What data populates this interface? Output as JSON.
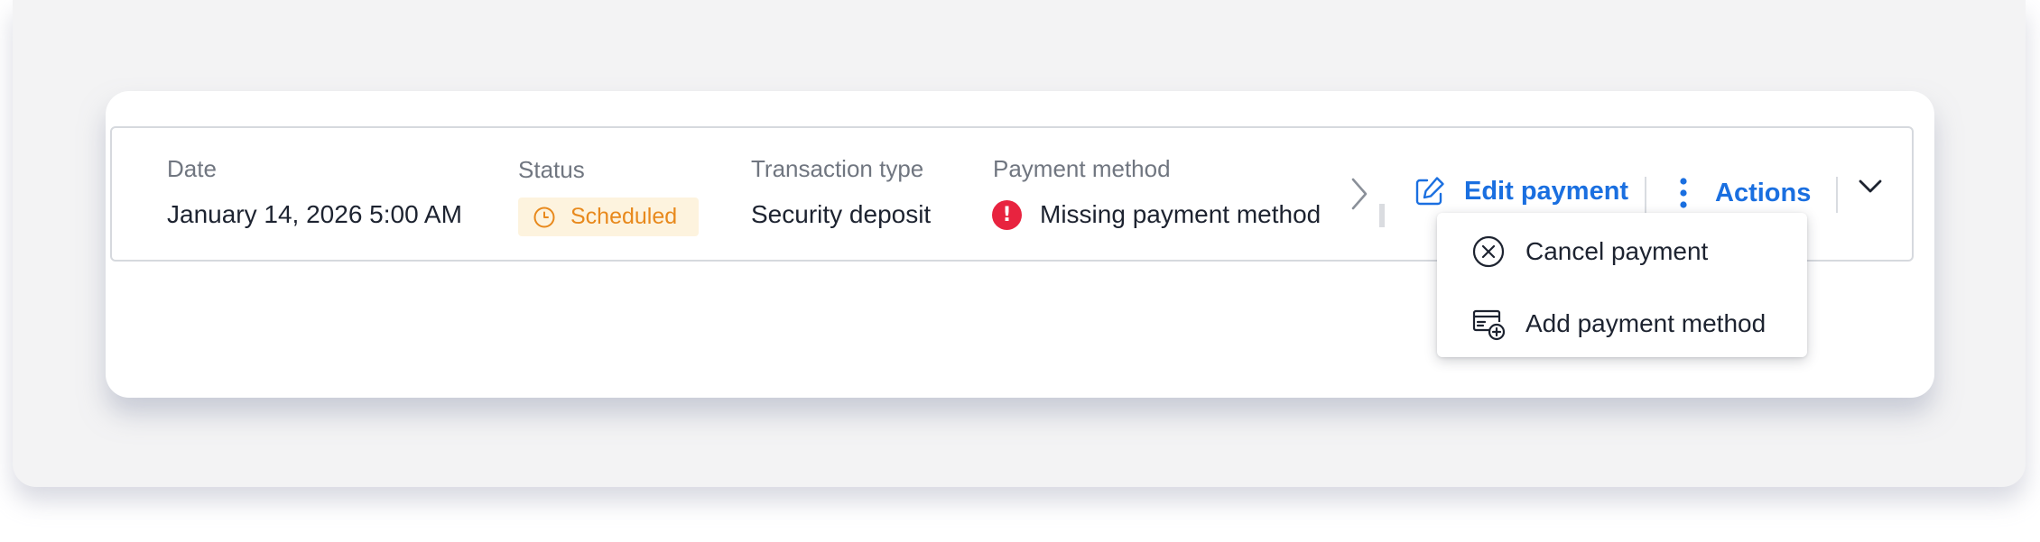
{
  "payment_row": {
    "date": {
      "label": "Date",
      "value": "January 14, 2026 5:00 AM"
    },
    "status": {
      "label": "Status",
      "value": "Scheduled",
      "icon": "clock-icon",
      "color": "#e8891c",
      "background": "#fdf3de"
    },
    "transaction_type": {
      "label": "Transaction type",
      "value": "Security deposit"
    },
    "payment_method": {
      "label": "Payment method",
      "value": "Missing payment method",
      "icon": "error-icon",
      "icon_color": "#e8233f"
    }
  },
  "actions": {
    "edit_label": "Edit payment",
    "actions_label": "Actions",
    "accent_color": "#1a6fe0"
  },
  "actions_menu": {
    "items": [
      {
        "label": "Cancel payment",
        "icon": "cancel-circle-icon"
      },
      {
        "label": "Add payment method",
        "icon": "add-card-icon"
      }
    ]
  }
}
